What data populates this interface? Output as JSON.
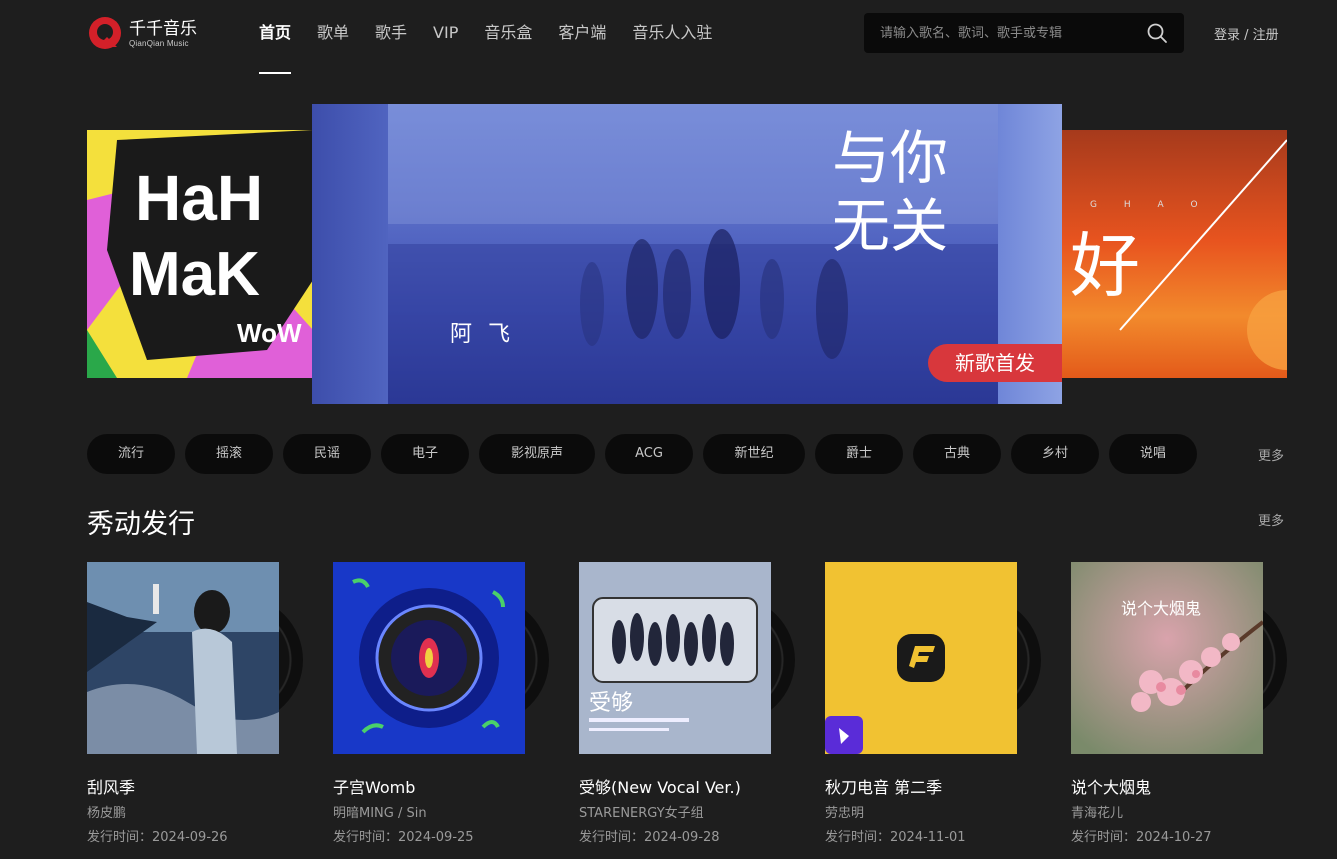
{
  "brand": {
    "name": "千千音乐",
    "sub": "QianQian Music"
  },
  "nav": [
    {
      "label": "首页",
      "active": true
    },
    {
      "label": "歌单"
    },
    {
      "label": "歌手"
    },
    {
      "label": "VIP"
    },
    {
      "label": "音乐盒"
    },
    {
      "label": "客户端"
    },
    {
      "label": "音乐人入驻"
    }
  ],
  "search": {
    "placeholder": "请输入歌名、歌词、歌手或专辑",
    "icon": "search-icon"
  },
  "auth": {
    "login": "登录",
    "separator": " / ",
    "register": "注册"
  },
  "banner": {
    "left_art": "HaHa MaKe WoW",
    "main": {
      "artist": "阿飞",
      "title": "与你无关",
      "tag": "新歌首发"
    },
    "right": {
      "text": "好",
      "sub": "G H A O"
    }
  },
  "genres": [
    "流行",
    "摇滚",
    "民谣",
    "电子",
    "影视原声",
    "ACG",
    "新世纪",
    "爵士",
    "古典",
    "乡村",
    "说唱"
  ],
  "genres_more": "更多",
  "section": {
    "title": "秀动发行",
    "more": "更多"
  },
  "albums": [
    {
      "title": "刮风季",
      "artist": "杨皮鹏",
      "date": "发行时间：2024-09-26"
    },
    {
      "title": "子宫Womb",
      "artist": "明暗MING / Sin",
      "date": "发行时间：2024-09-25"
    },
    {
      "title": "受够(New Vocal Ver.)",
      "artist": "STARENERGY女子组",
      "date": "发行时间：2024-09-28",
      "cover_text": "受够"
    },
    {
      "title": "秋刀电音 第二季",
      "artist": "劳忠明",
      "date": "发行时间：2024-11-01"
    },
    {
      "title": "说个大烟鬼",
      "artist": "青海花儿",
      "date": "发行时间：2024-10-27",
      "cover_text": "说个大烟鬼"
    }
  ],
  "colors": {
    "background": "#1e1e1e",
    "tag_red": "#d8373c",
    "logo_red": "#d32029",
    "fm_yellow": "#f1c232"
  }
}
